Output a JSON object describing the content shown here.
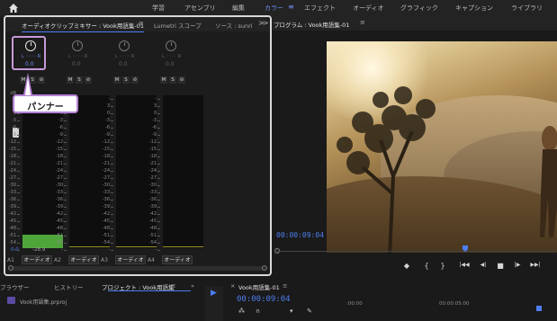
{
  "workspaces": {
    "items": [
      {
        "label": "学習",
        "x": 0
      },
      {
        "label": "アセンブリ"
      },
      {
        "label": "編集"
      },
      {
        "label": "カラー",
        "active": true
      },
      {
        "label": "エフェクト"
      },
      {
        "label": "オーディオ"
      },
      {
        "label": "グラフィック"
      },
      {
        "label": "キャプション"
      },
      {
        "label": "ライブラリ"
      }
    ],
    "menu_icon": "≡"
  },
  "mixer": {
    "tab_active": "オーディオクリップミキサー : Vook用語集-01",
    "tab_menu": "≡",
    "tab_lumetri": "Lumetri スコープ",
    "tab_source": "ソース : sunri",
    "overflow": ">>",
    "channels": [
      {
        "pan_lr": "L  ◦◦◦◦  R",
        "pan_value": "0.0",
        "m": "M",
        "s": "S",
        "r": "⊘",
        "name": "A1",
        "button": "オーディオ",
        "vol": "0.0",
        "peak": "-28.9",
        "level": 0.09,
        "active": true
      },
      {
        "pan_lr": "L  ◦◦◦◦  R",
        "pan_value": "0.0",
        "m": "M",
        "s": "S",
        "r": "⊘",
        "name": "A2",
        "button": "オーディオ",
        "vol": "",
        "peak": "",
        "level": 0
      },
      {
        "pan_lr": "L  ◦◦◦◦  R",
        "pan_value": "0.0",
        "m": "M",
        "s": "S",
        "r": "⊘",
        "name": "A3",
        "button": "オーディオ",
        "vol": "",
        "peak": "",
        "level": 0
      },
      {
        "pan_lr": "L  ◦◦◦◦  R",
        "pan_value": "0.0",
        "m": "M",
        "s": "S",
        "r": "⊘",
        "name": "A4",
        "button": "オーディオ",
        "vol": "",
        "peak": "",
        "level": 0
      }
    ],
    "db_label": "dB",
    "db_scale": [
      "-",
      "3",
      "0",
      "-3",
      "-6",
      "-9",
      "-12",
      "-15",
      "-18",
      "-21",
      "-24",
      "-27",
      "-30",
      "-33",
      "-36",
      "-39",
      "-42",
      "-45",
      "-48",
      "-51",
      "-54",
      "-"
    ]
  },
  "callout": {
    "text": "パンナー"
  },
  "program": {
    "title": "プログラム : Vook用語集-01",
    "menu": "≡",
    "timecode": "00:00:09:04",
    "transport": [
      "◆",
      "{",
      "}",
      "|◀◀",
      "◀|",
      "■",
      "|▶",
      "▶▶|"
    ]
  },
  "bottom": {
    "tabs": [
      {
        "label": "ブラウザー"
      },
      {
        "label": "ヒストリー"
      },
      {
        "label": "プロジェクト : Vook用語集",
        "active": true
      },
      {
        "label": "≡"
      },
      {
        "label": "»"
      }
    ],
    "project_file": "Vook用語集.prproj",
    "sequence_tab": "Vook用語集-01",
    "sequence_menu": "≡",
    "sequence_close": "×",
    "sequence_timecode": "00:00:09:04",
    "ruler_start": ":00:00",
    "ruler_mid": "00:00:05:00"
  }
}
